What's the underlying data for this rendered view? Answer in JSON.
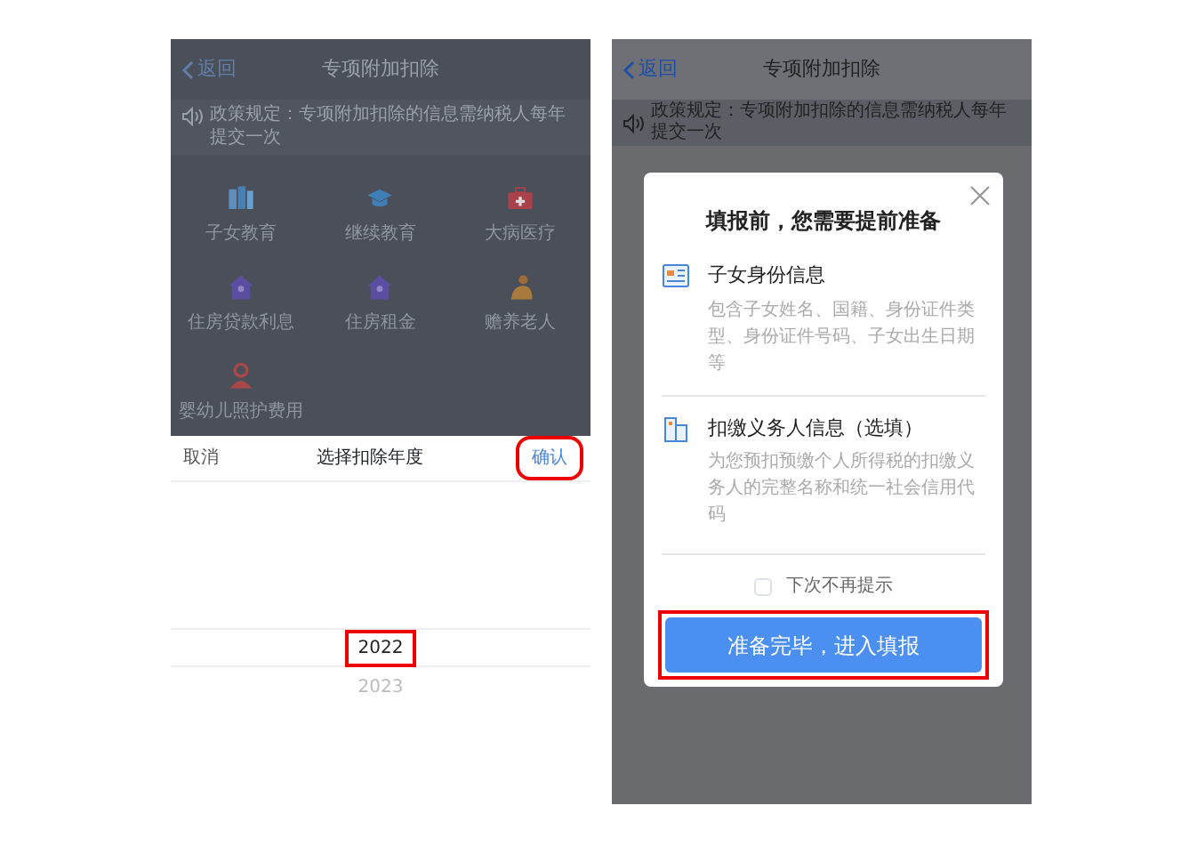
{
  "screens": [
    {
      "nav": {
        "back": "返回",
        "title": "专项附加扣除"
      },
      "notice": "政策规定：专项附加扣除的信息需纳税人每年提交一次",
      "categories": [
        {
          "label": "子女教育",
          "kind": "books"
        },
        {
          "label": "继续教育",
          "kind": "cap"
        },
        {
          "label": "大病医疗",
          "kind": "medkit"
        },
        {
          "label": "住房贷款利息",
          "kind": "house"
        },
        {
          "label": "住房租金",
          "kind": "house"
        },
        {
          "label": "赡养老人",
          "kind": "elder"
        },
        {
          "label": "婴幼儿照护费用",
          "kind": "child"
        }
      ],
      "picker": {
        "cancel": "取消",
        "title": "选择扣除年度",
        "confirm": {
          "label": "确认",
          "highlighted": true
        },
        "years": [
          {
            "label": "2022",
            "selected": true,
            "highlighted": true
          },
          {
            "label": "2023",
            "selected": false,
            "highlighted": false
          }
        ]
      }
    },
    {
      "nav": {
        "back": "返回",
        "title": "专项附加扣除"
      },
      "notice": "政策规定：专项附加扣除的信息需纳税人每年提交一次",
      "modal": {
        "title": "填报前，您需要提前准备",
        "items": [
          {
            "kind": "id-card",
            "title": "子女身份信息",
            "description": "包含子女姓名、国籍、身份证件类型、身份证件号码、子女出生日期等"
          },
          {
            "kind": "building",
            "title": "扣缴义务人信息（选填）",
            "description": "为您预扣预缴个人所得税的扣缴义务人的完整名称和统一社会信用代码"
          }
        ],
        "checkbox": {
          "label": "下次不再提示",
          "checked": false
        },
        "submit": {
          "label": "准备完毕，进入填报",
          "highlighted": true
        }
      }
    }
  ]
}
